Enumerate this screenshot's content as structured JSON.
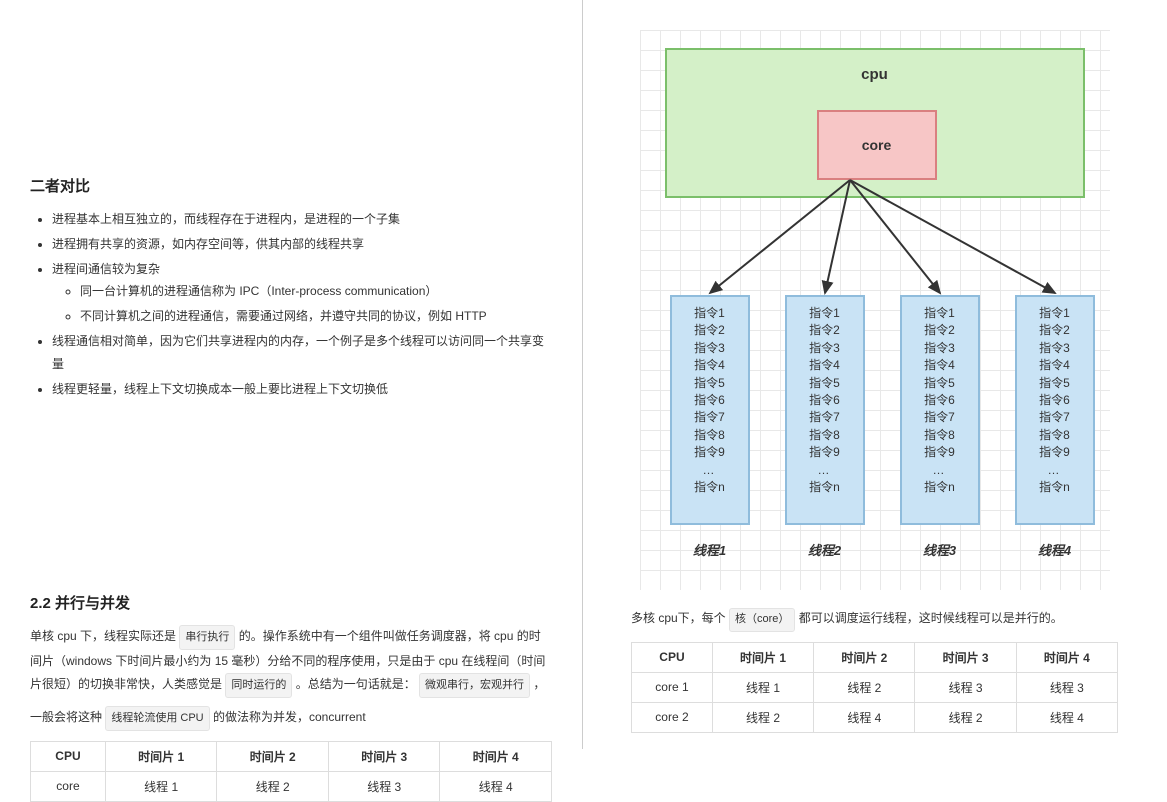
{
  "left": {
    "comparison": {
      "heading": "二者对比",
      "items": {
        "i1": "进程基本上相互独立的，而线程存在于进程内，是进程的一个子集",
        "i2": "进程拥有共享的资源，如内存空间等，供其内部的线程共享",
        "i3": "进程间通信较为复杂",
        "i3a": "同一台计算机的进程通信称为 IPC（Inter-process communication）",
        "i3b": "不同计算机之间的进程通信，需要通过网络，并遵守共同的协议，例如 HTTP",
        "i4": "线程通信相对简单，因为它们共享进程内的内存，一个例子是多个线程可以访问同一个共享变量",
        "i5": "线程更轻量，线程上下文切换成本一般上要比进程上下文切换低"
      }
    },
    "sec22": {
      "heading": "2.2 并行与并发",
      "p1a": "单核 cpu 下，线程实际还是 ",
      "p1_hl1": "串行执行",
      "p1b": " 的。操作系统中有一个组件叫做任务调度器，将 cpu 的时间片（windows 下时间片最小约为 15 毫秒）分给不同的程序使用，只是由于 cpu 在线程间（时间片很短）的切换非常快，人类感觉是 ",
      "p1_hl2": "同时运行的",
      "p1c": " 。总结为一句话就是：",
      "p1_hl3": "微观串行，宏观并行",
      "p1d": " ，",
      "p2a": "一般会将这种 ",
      "p2_hl": "线程轮流使用 CPU",
      "p2b": " 的做法称为并发，concurrent"
    },
    "table": {
      "h0": "CPU",
      "h1": "时间片 1",
      "h2": "时间片 2",
      "h3": "时间片 3",
      "h4": "时间片 4",
      "r1c0": "core",
      "r1c1": "线程 1",
      "r1c2": "线程 2",
      "r1c3": "线程 3",
      "r1c4": "线程 4"
    }
  },
  "right": {
    "diagram": {
      "cpu": "cpu",
      "core": "core",
      "instructions": {
        "l1": "指令1",
        "l2": "指令2",
        "l3": "指令3",
        "l4": "指令4",
        "l5": "指令5",
        "l6": "指令6",
        "l7": "指令7",
        "l8": "指令8",
        "l9": "指令9",
        "ell": "…",
        "ln": "指令n"
      },
      "threads": {
        "t1": "线程1",
        "t2": "线程2",
        "t3": "线程3",
        "t4": "线程4"
      }
    },
    "p_a": "多核 cpu下，每个 ",
    "p_hl": "核（core）",
    "p_b": " 都可以调度运行线程，这时候线程可以是并行的。",
    "table": {
      "h0": "CPU",
      "h1": "时间片 1",
      "h2": "时间片 2",
      "h3": "时间片 3",
      "h4": "时间片 4",
      "r1c0": "core 1",
      "r1c1": "线程 1",
      "r1c2": "线程 2",
      "r1c3": "线程 3",
      "r1c4": "线程 3",
      "r2c0": "core 2",
      "r2c1": "线程 2",
      "r2c2": "线程 4",
      "r2c3": "线程 2",
      "r2c4": "线程 4"
    }
  }
}
